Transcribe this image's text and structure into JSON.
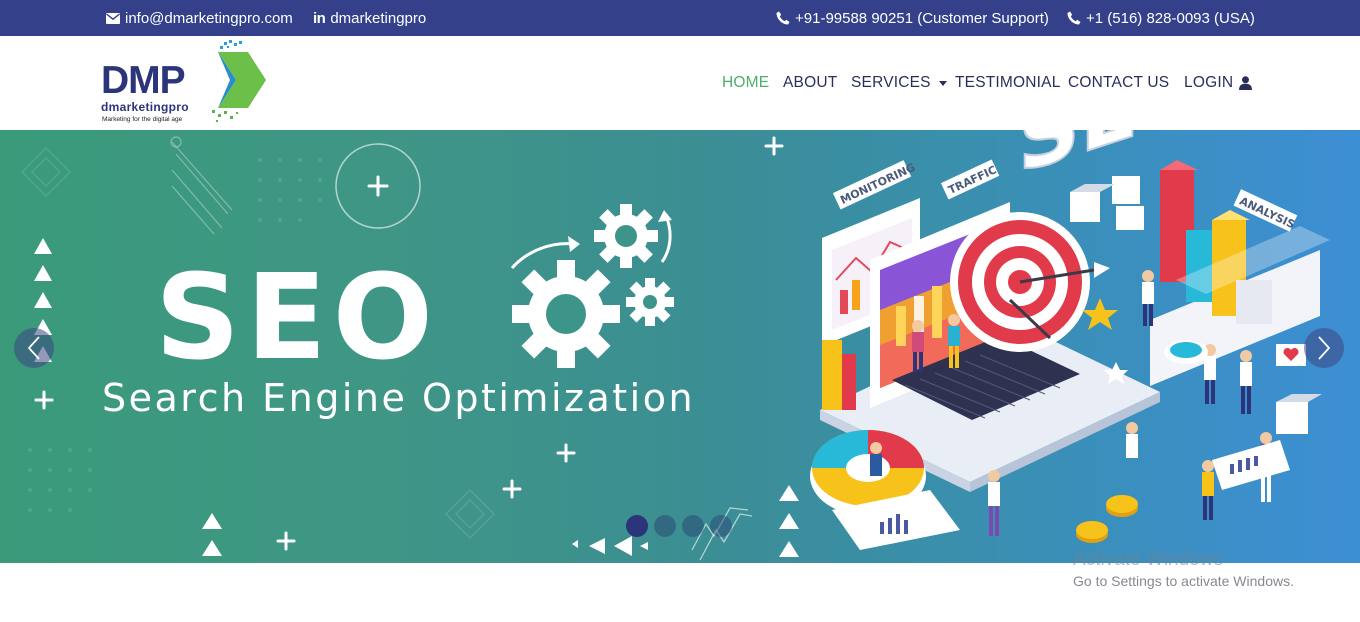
{
  "topbar": {
    "email": "info@dmarketingpro.com",
    "linkedin": "dmarketingpro",
    "linkedin_glyph": "in",
    "phone_support": "+91-99588 90251 (Customer Support)",
    "phone_usa": "+1 (516) 828-0093 (USA)",
    "icons": [
      "envelope-icon",
      "linkedin-icon",
      "phone-icon",
      "phone-icon"
    ]
  },
  "logo": {
    "wordmark": "DMP",
    "name": "dmarketingpro",
    "tagline": "Marketing for the digital age"
  },
  "nav": {
    "items": [
      {
        "label": "HOME",
        "active": true
      },
      {
        "label": "ABOUT"
      },
      {
        "label": "SERVICES",
        "dropdown": true
      },
      {
        "label": "TESTIMONIAL"
      },
      {
        "label": "CONTACT US"
      },
      {
        "label": "LOGIN",
        "icon": "user-icon"
      }
    ]
  },
  "hero": {
    "title": "SEO",
    "subtitle": "Search Engine Optimization",
    "illustration_labels": {
      "monitoring": "MONITORING",
      "traffic": "TRAFFIC",
      "analysis": "ANALYSIS",
      "seo_letters": "SEO"
    },
    "slide_count": 4,
    "active_slide": 1
  },
  "watermark": {
    "line1": "Activate Windows",
    "line2": "Go to Settings to activate Windows."
  },
  "colors": {
    "topbar": "#34418a",
    "nav_active": "#4caf6a",
    "nav_text": "#2a2f5a",
    "brand_navy": "#2c3579"
  }
}
